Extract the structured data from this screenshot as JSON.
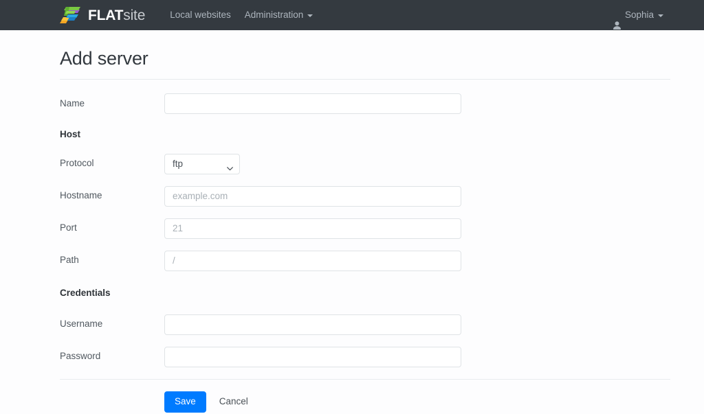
{
  "navbar": {
    "brand": {
      "name_bold": "FLAT",
      "name_light": "site",
      "logo_icon": "flatsite-logo-icon"
    },
    "links": [
      {
        "label": "Local websites",
        "has_caret": false
      },
      {
        "label": "Administration",
        "has_caret": true
      }
    ],
    "user": {
      "label": "Sophia",
      "icon": "user-icon",
      "has_caret": true
    },
    "background_color": "#343a40"
  },
  "page": {
    "title": "Add server"
  },
  "form": {
    "name": {
      "label": "Name",
      "value": "",
      "placeholder": ""
    },
    "sections": {
      "host": "Host",
      "credentials": "Credentials"
    },
    "protocol": {
      "label": "Protocol",
      "selected": "ftp",
      "options": [
        "ftp"
      ]
    },
    "hostname": {
      "label": "Hostname",
      "value": "",
      "placeholder": "example.com"
    },
    "port": {
      "label": "Port",
      "value": "",
      "placeholder": "21"
    },
    "path": {
      "label": "Path",
      "value": "",
      "placeholder": "/"
    },
    "username": {
      "label": "Username",
      "value": "",
      "placeholder": ""
    },
    "password": {
      "label": "Password",
      "value": "",
      "placeholder": ""
    }
  },
  "actions": {
    "save_label": "Save",
    "cancel_label": "Cancel",
    "primary_color": "#007bff"
  }
}
